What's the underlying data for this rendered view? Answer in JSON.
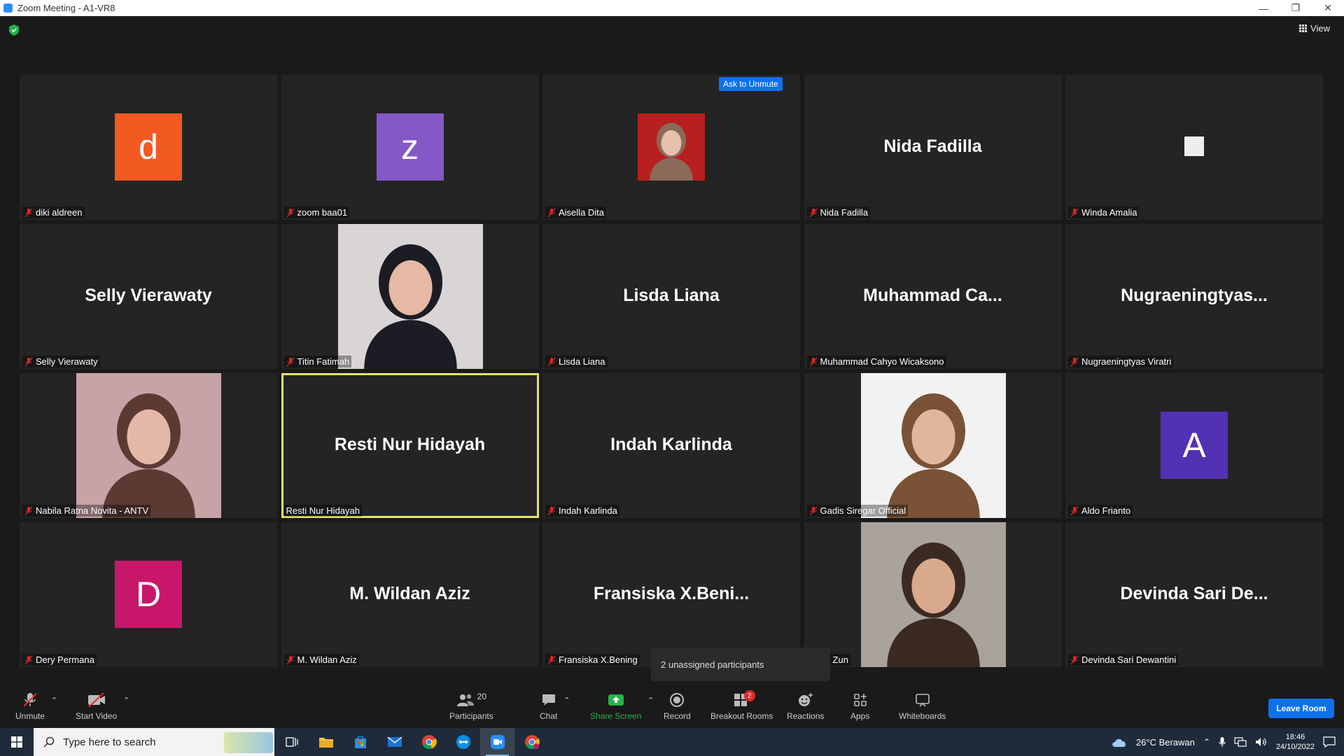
{
  "window": {
    "title": "Zoom Meeting - A1-VR8"
  },
  "top": {
    "view_label": "View"
  },
  "tiles": [
    {
      "name": "diki aldreen",
      "kind": "avatar",
      "initial": "d",
      "color": "#f25a22"
    },
    {
      "name": "zoom baa01",
      "kind": "avatar",
      "initial": "z",
      "color": "#8558c8"
    },
    {
      "name": "Aisella Dita",
      "kind": "photo-small",
      "badge": "Ask to Unmute"
    },
    {
      "name": "Nida Fadilla",
      "kind": "text",
      "display": "Nida Fadilla"
    },
    {
      "name": "Winda Amalia",
      "kind": "blank"
    },
    {
      "name": "Selly Vierawaty",
      "kind": "text",
      "display": "Selly Vierawaty"
    },
    {
      "name": "Titin Fatimah",
      "kind": "photo"
    },
    {
      "name": "Lisda Liana",
      "kind": "text",
      "display": "Lisda Liana"
    },
    {
      "name": "Muhammad Cahyo Wicaksono",
      "kind": "text",
      "display": "Muhammad  Ca..."
    },
    {
      "name": "Nugraeningtyas Viratri",
      "kind": "text",
      "display": "Nugraeningtyas..."
    },
    {
      "name": "Nabila Ratna Novita - ANTV",
      "kind": "photo"
    },
    {
      "name": "Resti Nur Hidayah",
      "kind": "text",
      "display": "Resti Nur Hidayah",
      "active": true
    },
    {
      "name": "Indah Karlinda",
      "kind": "text",
      "display": "Indah Karlinda"
    },
    {
      "name": "Gadis Siregar Official",
      "kind": "photo"
    },
    {
      "name": "Aldo Frianto",
      "kind": "avatar",
      "initial": "A",
      "color": "#5331b5"
    },
    {
      "name": "Dery Permana",
      "kind": "avatar",
      "initial": "D",
      "color": "#c8176a"
    },
    {
      "name": "M. Wildan Aziz",
      "kind": "text",
      "display": "M. Wildan Aziz"
    },
    {
      "name": "Fransiska X.Bening",
      "kind": "text",
      "display": "Fransiska  X.Beni..."
    },
    {
      "name": "lar Zun",
      "kind": "photo"
    },
    {
      "name": "Devinda Sari Dewantini",
      "kind": "text",
      "display": "Devinda  Sari  De..."
    }
  ],
  "popup": {
    "unassigned": "2 unassigned participants"
  },
  "toolbar": {
    "unmute": "Unmute",
    "start_video": "Start Video",
    "participants": "Participants",
    "participants_count": "20",
    "chat": "Chat",
    "share_screen": "Share Screen",
    "record": "Record",
    "breakout_rooms": "Breakout Rooms",
    "breakout_badge": "2",
    "reactions": "Reactions",
    "apps": "Apps",
    "whiteboards": "Whiteboards",
    "leave": "Leave Room"
  },
  "taskbar": {
    "search_placeholder": "Type here to search",
    "weather": "26°C  Berawan",
    "time": "18:46",
    "date": "24/10/2022"
  },
  "colors": {
    "accent": "#0e71eb",
    "active_speaker": "#e8e26c",
    "green": "#27b24a",
    "muted_red": "#e02828"
  }
}
